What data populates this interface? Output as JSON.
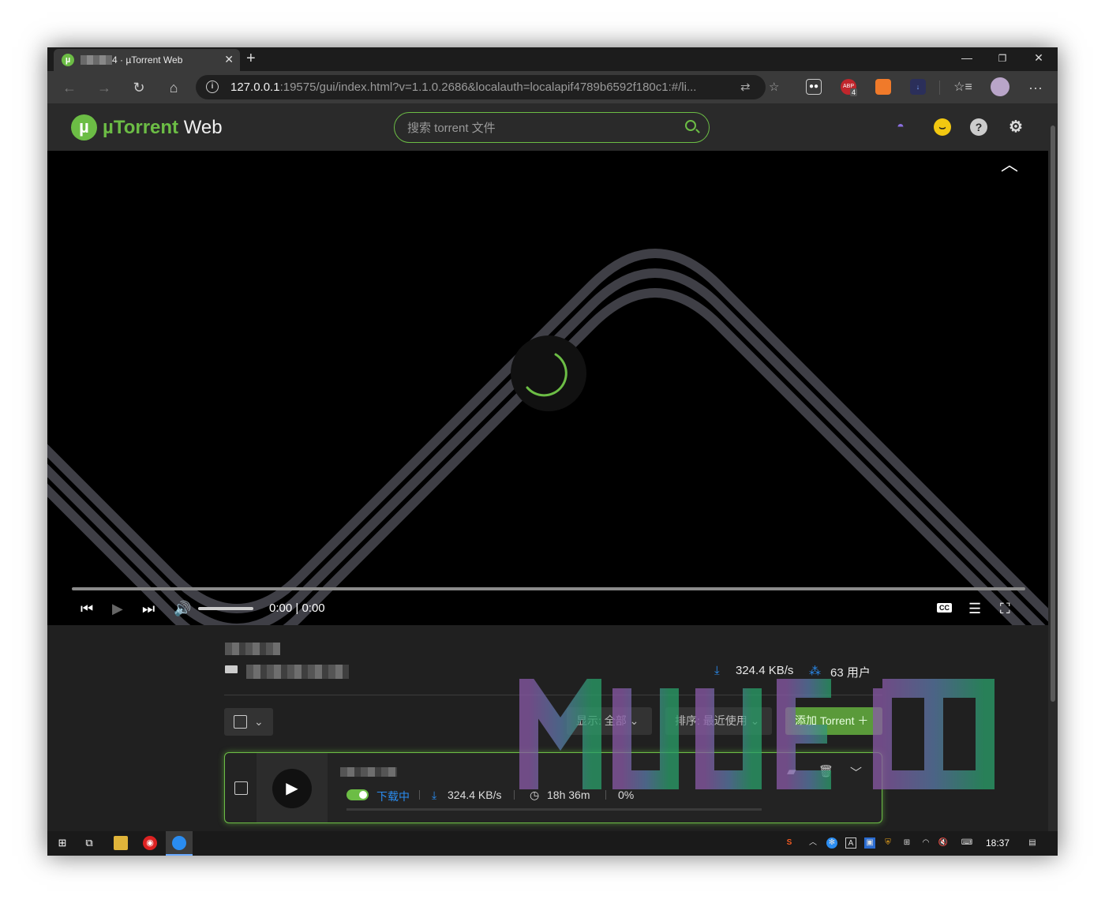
{
  "browser": {
    "tab_title": "4 · µTorrent Web",
    "url_host": "127.0.0.1",
    "url_rest": ":19575/gui/index.html?v=1.1.0.2686&localauth=localapif4789b6592f180c1:#/li...",
    "ext_abp_badge": "4"
  },
  "app": {
    "logo_mu": "µ",
    "logo_torrent": "Torrent",
    "logo_web": " Web",
    "search_placeholder": "搜索 torrent 文件"
  },
  "player": {
    "time_current": "0:00",
    "time_sep": " | ",
    "time_total": "0:00",
    "progress": 0,
    "cc_label": "CC"
  },
  "torrent_info": {
    "download_speed": "324.4 KB/s",
    "peers": "63 用户"
  },
  "filters": {
    "show_label": "显示:",
    "show_value": "全部",
    "sort_label": "排序:",
    "sort_value": "最近使用",
    "add_label": "添加 Torrent ＋"
  },
  "torrent_item": {
    "status": "下载中",
    "speed": "324.4 KB/s",
    "eta": "18h 36m",
    "percent": "0%",
    "progress": 0
  },
  "taskbar": {
    "clock": "18:37"
  },
  "watermark": {
    "text": "MUUESD"
  },
  "colors": {
    "brand_green": "#6cbd45",
    "link_blue": "#2a8cf0",
    "window_bg": "#202020"
  }
}
